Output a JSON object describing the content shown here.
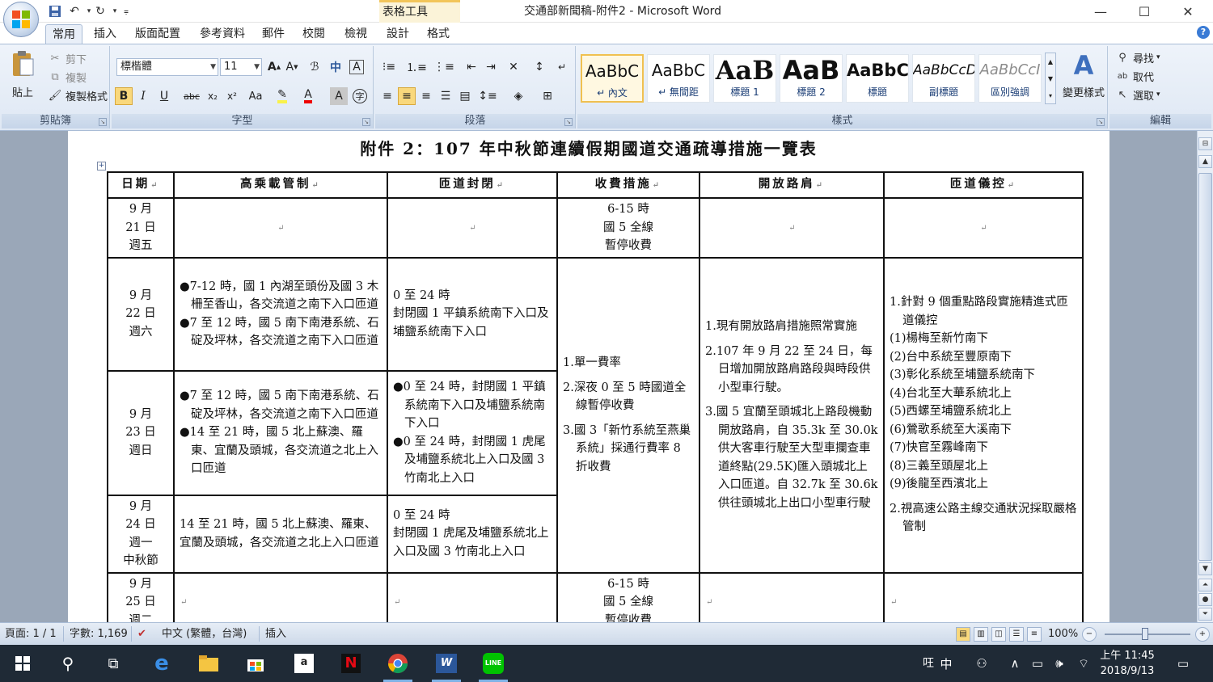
{
  "window": {
    "title": "交通部新聞稿-附件2 - Microsoft Word",
    "contextual_tab_group": "表格工具",
    "controls": {
      "minimize": "—",
      "maximize": "☐",
      "close": "✕"
    }
  },
  "qat": {
    "save_icon": "save-icon",
    "undo_icon": "undo-icon",
    "redo_icon": "redo-icon"
  },
  "tabs": [
    {
      "label": "常用",
      "active": true
    },
    {
      "label": "插入"
    },
    {
      "label": "版面配置"
    },
    {
      "label": "參考資料"
    },
    {
      "label": "郵件"
    },
    {
      "label": "校閱"
    },
    {
      "label": "檢視"
    },
    {
      "label": "設計"
    },
    {
      "label": "格式"
    }
  ],
  "ribbon": {
    "clipboard": {
      "paste": "貼上",
      "cut": "剪下",
      "copy": "複製",
      "format_painter": "複製格式",
      "group_label": "剪貼簿"
    },
    "font": {
      "font_name": "標楷體",
      "font_size": "11",
      "group_label": "字型",
      "change_case": "Aa"
    },
    "paragraph": {
      "group_label": "段落"
    },
    "styles": {
      "group_label": "樣式",
      "items": [
        {
          "sample": "AaBbC",
          "name": "↵ 內文",
          "selected": true
        },
        {
          "sample": "AaBbC",
          "name": "↵ 無間距"
        },
        {
          "sample": "AaB",
          "name": "標題 1"
        },
        {
          "sample": "AaB",
          "name": "標題 2"
        },
        {
          "sample": "AaBbC",
          "name": "標題"
        },
        {
          "sample": "AaBbCcD",
          "name": "副標題"
        },
        {
          "sample": "AaBbCcI",
          "name": "區別強調"
        }
      ],
      "change_styles": "變更樣式"
    },
    "editing": {
      "find": "尋找",
      "replace": "取代",
      "select": "選取",
      "group_label": "編輯"
    }
  },
  "document": {
    "title": "附件 2：107 年中秋節連續假期國道交通疏導措施一覽表",
    "table": {
      "headers": [
        "日期",
        "高乘載管制",
        "匝道封閉",
        "收費措施",
        "開放路肩",
        "匝道儀控"
      ],
      "rows": [
        {
          "date": [
            "9 月",
            "21 日",
            "週五"
          ],
          "hov": [],
          "ramp_closure": [],
          "toll": [
            "6-15 時",
            "國 5 全線",
            "暫停收費"
          ],
          "shoulder": [],
          "metering": []
        },
        {
          "date": [
            "9 月",
            "22 日",
            "週六"
          ],
          "hov": [
            "●7-12 時，國 1 內湖至頭份及國 3 木柵至香山，各交流道之南下入口匝道",
            "●7 至 12 時，國 5 南下南港系統、石碇及坪林，各交流道之南下入口匝道"
          ],
          "ramp_closure": [
            "0 至 24 時",
            "封閉國 1 平鎮系統南下入口及埔鹽系統南下入口"
          ]
        },
        {
          "date": [
            "9 月",
            "23 日",
            "週日"
          ],
          "hov": [
            "●7 至 12 時，國 5 南下南港系統、石碇及坪林，各交流道之南下入口匝道",
            "●14 至 21 時，國 5 北上蘇澳、羅東、宜蘭及頭城，各交流道之北上入口匝道"
          ],
          "ramp_closure": [
            "●0 至 24 時，封閉國 1 平鎮系統南下入口及埔鹽系統南下入口",
            "●0 至 24 時，封閉國 1 虎尾及埔鹽系統北上入口及國 3 竹南北上入口"
          ]
        },
        {
          "date": [
            "9 月",
            "24 日",
            "週一",
            "中秋節"
          ],
          "hov": [
            "14 至 21 時，國 5 北上蘇澳、羅東、宜蘭及頭城，各交流道之北上入口匝道"
          ],
          "ramp_closure": [
            "0 至 24 時",
            "封閉國 1 虎尾及埔鹽系統北上入口及國 3 竹南北上入口"
          ]
        },
        {
          "date": [
            "9 月",
            "25 日",
            "週二"
          ],
          "hov": [],
          "ramp_closure": [],
          "toll": [
            "6-15 時",
            "國 5 全線",
            "暫停收費"
          ],
          "shoulder": [],
          "metering": []
        }
      ],
      "merged_toll": [
        "1.單一費率",
        "2.深夜 0 至 5 時國道全線暫停收費",
        "3.國 3「新竹系統至燕巢系統」採通行費率 8 折收費"
      ],
      "merged_shoulder": [
        "1.現有開放路肩措施照常實施",
        "2.107 年 9 月 22 至 24 日，每日增加開放路肩路段與時段供小型車行駛。",
        "3.國 5 宜蘭至頭城北上路段機動開放路肩，自 35.3k 至 30.0k 供大客車行駛至大型車攔查車道終點(29.5K)匯入頭城北上入口匝道。自 32.7k 至 30.6k 供往頭城北上出口小型車行駛"
      ],
      "merged_metering": [
        "1.針對 9 個重點路段實施精進式匝道儀控",
        "(1)楊梅至新竹南下",
        "(2)台中系統至豐原南下",
        "(3)彰化系統至埔鹽系統南下",
        "(4)台北至大華系統北上",
        "(5)西螺至埔鹽系統北上",
        "(6)鶯歌系統至大溪南下",
        "(7)快官至霧峰南下",
        "(8)三義至頭屋北上",
        "(9)後龍至西濱北上",
        "2.視高速公路主線交通狀況採取嚴格管制"
      ]
    }
  },
  "statusbar": {
    "page": "頁面: 1 / 1",
    "words": "字數: 1,169",
    "language": "中文 (繁體，台灣)",
    "mode": "插入",
    "zoom": "100%"
  },
  "taskbar": {
    "ime_mode": "中",
    "ime_extra": "㕵",
    "time": "上午 11:45",
    "date": "2018/9/13"
  },
  "colors": {
    "ribbon_bg": "#dfe8f4",
    "accent": "#2b579a",
    "taskbar": "#1f2a36"
  }
}
